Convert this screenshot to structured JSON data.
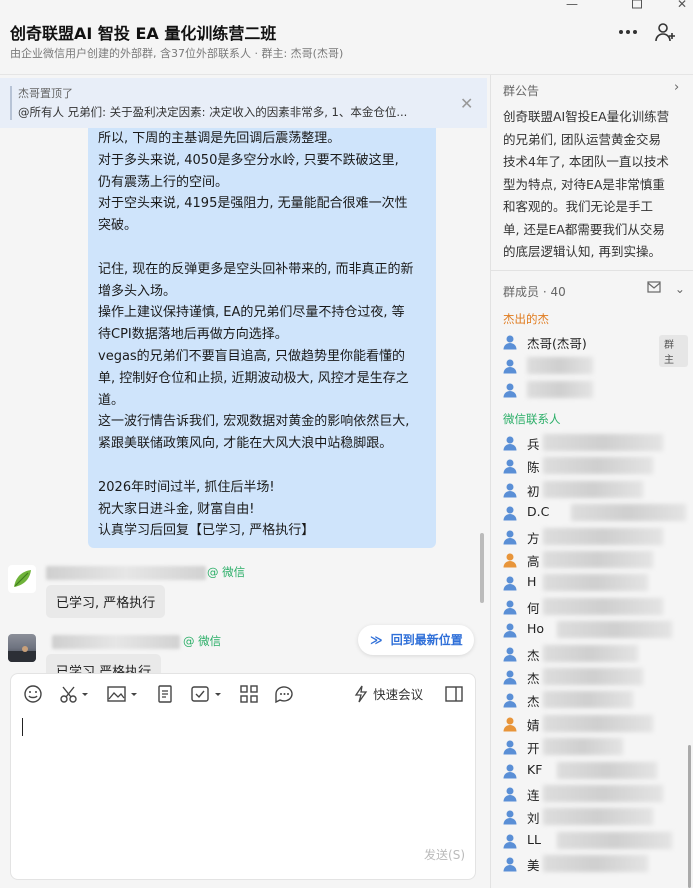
{
  "window": {
    "title": "创奇联盟AI 智投 EA 量化训练营二班",
    "subtitle": "由企业微信用户创建的外部群, 含37位外部联系人 · 群主: 杰哥(杰哥)"
  },
  "pinned": {
    "who": "杰哥置顶了",
    "text": "@所有人 兄弟们: 关于盈利决定因素: 决定收入的因素非常多, 1、本金仓位..."
  },
  "chat": {
    "main_message_lines": [
      "所以, 下周的主基调是先回调后震荡整理。",
      "对于多头来说, 4050是多空分水岭, 只要不跌破这里,",
      "仍有震荡上行的空间。",
      "对于空头来说, 4195是强阻力, 无量能配合很难一次性",
      "突破。",
      "",
      "记住, 现在的反弹更多是空头回补带来的, 而非真正的新",
      "增多头入场。",
      "操作上建议保持谨慎, EA的兄弟们尽量不持仓过夜, 等",
      "待CPI数据落地后再做方向选择。",
      "vegas的兄弟们不要盲目追高, 只做趋势里你能看懂的",
      "单, 控制好仓位和止损, 近期波动极大, 风控才是生存之",
      "道。",
      "这一波行情告诉我们, 宏观数据对黄金的影响依然巨大,",
      "紧跟美联储政策风向, 才能在大风大浪中站稳脚跟。",
      "",
      "2026年时间过半, 抓住后半场!",
      "祝大家日进斗金, 财富自由!",
      "认真学习后回复【已学习, 严格执行】"
    ],
    "replies": [
      {
        "tag": "@ 微信",
        "text": "已学习, 严格执行"
      },
      {
        "tag": "@ 微信",
        "text": "已学习 严格执行"
      }
    ],
    "jump_label": "回到最新位置"
  },
  "input": {
    "meeting_label": "快速会议",
    "send_label": "发送(S)"
  },
  "announcement": {
    "title": "群公告",
    "lines": [
      "创奇联盟AI智投EA量化训练营",
      "的兄弟们, 团队运营黄金交易",
      "技术4年了, 本团队一直以技术",
      "型为特点, 对待EA是非常慎重",
      "和客观的。我们无论是手工",
      "单, 还是EA都需要我们从交易",
      "的底层逻辑认知, 再到实操。",
      "一定要理解两个事实, 第一"
    ]
  },
  "members": {
    "title": "群成员 · 40",
    "group1_label": "杰出的杰",
    "group2_label": "微信联系人",
    "owner": {
      "name": "杰哥(杰哥)",
      "badge": "群主"
    },
    "wechat_visible": [
      "兵",
      "陈",
      "初",
      "D.C",
      "方",
      "高",
      "H",
      "何",
      "Ho",
      "杰",
      "杰",
      "杰",
      "婧",
      "开",
      "KF",
      "连",
      "刘",
      "LL",
      "美"
    ]
  },
  "colors": {
    "bubble": "#cfe4fb",
    "accent_blue": "#2f6fd8",
    "wechat_green": "#2aae67",
    "group_orange": "#e07b1e",
    "member_blue": "#5a8fd6",
    "member_orange": "#e8953a"
  }
}
